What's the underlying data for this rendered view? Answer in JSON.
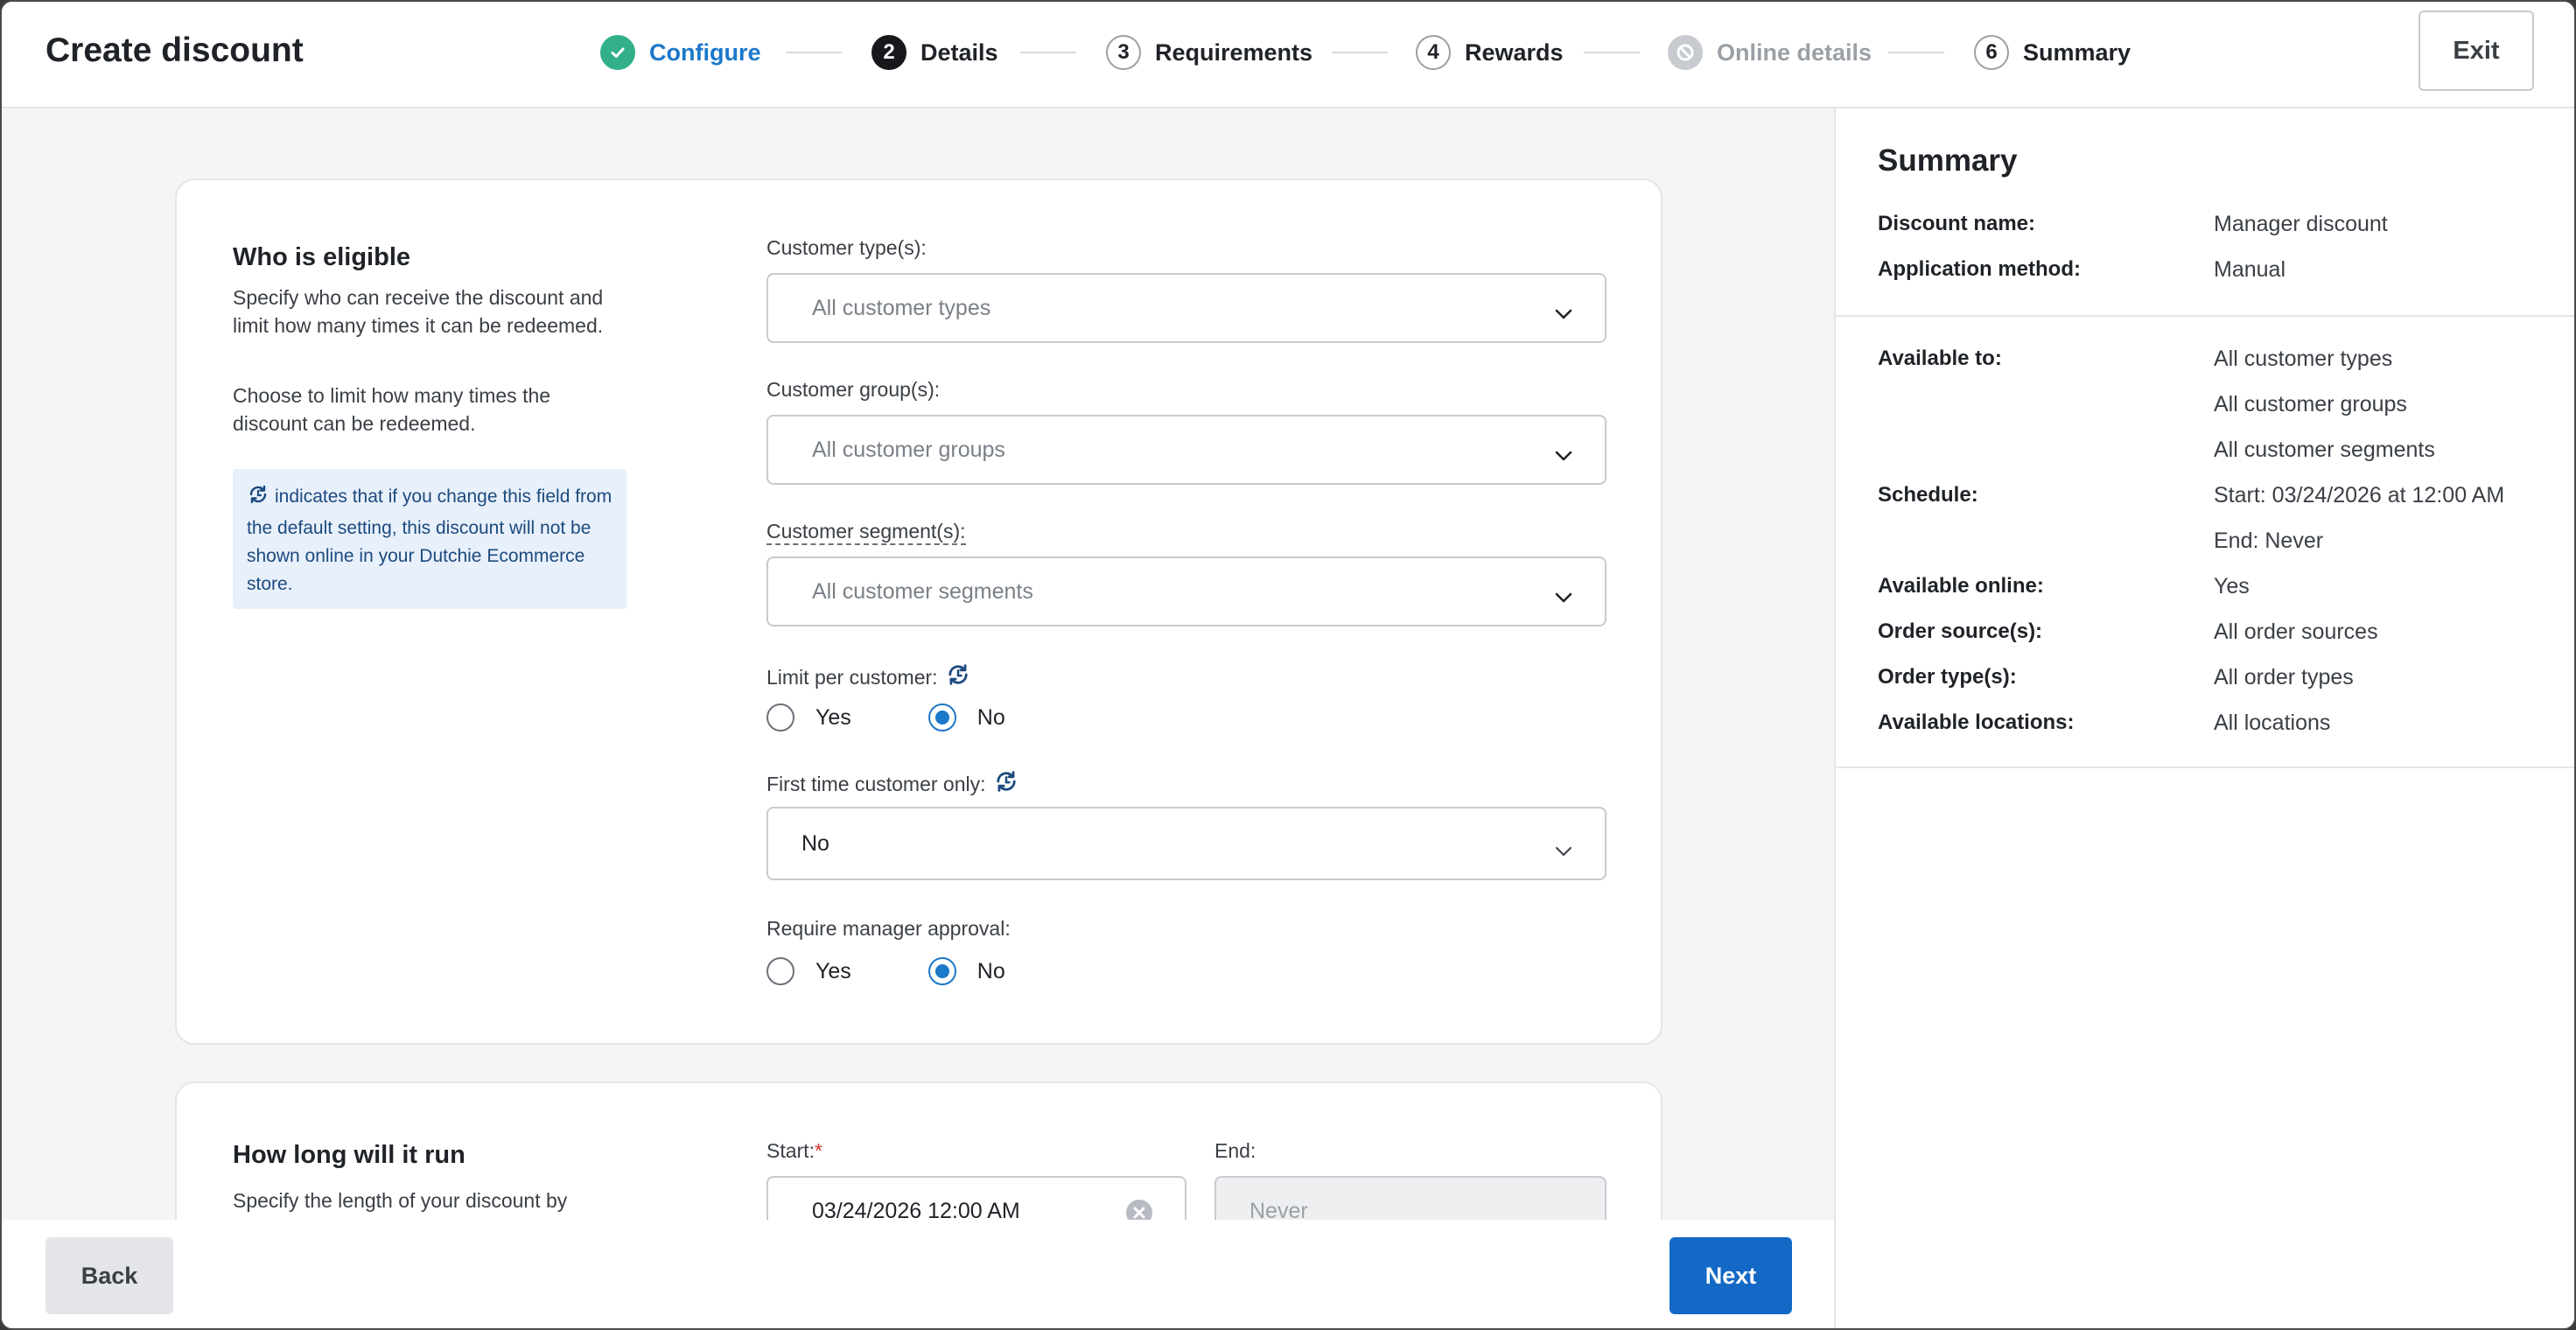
{
  "header": {
    "title": "Create discount",
    "exit_label": "Exit",
    "steps": [
      {
        "num": "",
        "label": "Configure",
        "state": "complete"
      },
      {
        "num": "2",
        "label": "Details",
        "state": "current"
      },
      {
        "num": "3",
        "label": "Requirements",
        "state": "upcoming"
      },
      {
        "num": "4",
        "label": "Rewards",
        "state": "upcoming"
      },
      {
        "num": "",
        "label": "Online details",
        "state": "disabled"
      },
      {
        "num": "6",
        "label": "Summary",
        "state": "upcoming"
      }
    ]
  },
  "eligible": {
    "title": "Who is eligible",
    "desc1": "Specify who can receive the discount and limit how many times it can be redeemed.",
    "desc2": "Choose to limit how many times the discount can be redeemed.",
    "info": "indicates that if you change this field from the default setting, this discount will not be shown online in your Dutchie Ecommerce store.",
    "customer_types_label": "Customer type(s):",
    "customer_types_placeholder": "All customer types",
    "customer_groups_label": "Customer group(s):",
    "customer_groups_placeholder": "All customer groups",
    "customer_segments_label": "Customer segment(s):",
    "customer_segments_placeholder": "All customer segments",
    "limit_label": "Limit per customer:",
    "limit_options": {
      "yes": "Yes",
      "no": "No",
      "selected": "No"
    },
    "first_time_label": "First time customer only:",
    "first_time_value": "No",
    "manager_label": "Require manager approval:",
    "manager_options": {
      "yes": "Yes",
      "no": "No",
      "selected": "No"
    }
  },
  "run": {
    "title": "How long will it run",
    "desc": "Specify the length of your discount by",
    "start_label": "Start:",
    "start_required": "*",
    "start_value": "03/24/2026 12:00 AM",
    "end_label": "End:",
    "end_placeholder": "Never"
  },
  "footer": {
    "back_label": "Back",
    "next_label": "Next"
  },
  "summary": {
    "title": "Summary",
    "discount_name_label": "Discount name:",
    "discount_name_value": "Manager discount",
    "application_label": "Application method:",
    "application_value": "Manual",
    "available_to_label": "Available to:",
    "available_to_values": [
      "All customer types",
      "All customer groups",
      "All customer segments"
    ],
    "schedule_label": "Schedule:",
    "schedule_values": [
      "Start: 03/24/2026 at 12:00 AM",
      "End: Never"
    ],
    "online_label": "Available online:",
    "online_value": "Yes",
    "order_sources_label": "Order source(s):",
    "order_sources_value": "All order sources",
    "order_types_label": "Order type(s):",
    "order_types_value": "All order types",
    "locations_label": "Available locations:",
    "locations_value": "All locations"
  },
  "colors": {
    "accent": "#1c78c9",
    "primary_button": "#1469c7",
    "complete": "#32b08a",
    "info_bg": "#e8f0fb"
  }
}
